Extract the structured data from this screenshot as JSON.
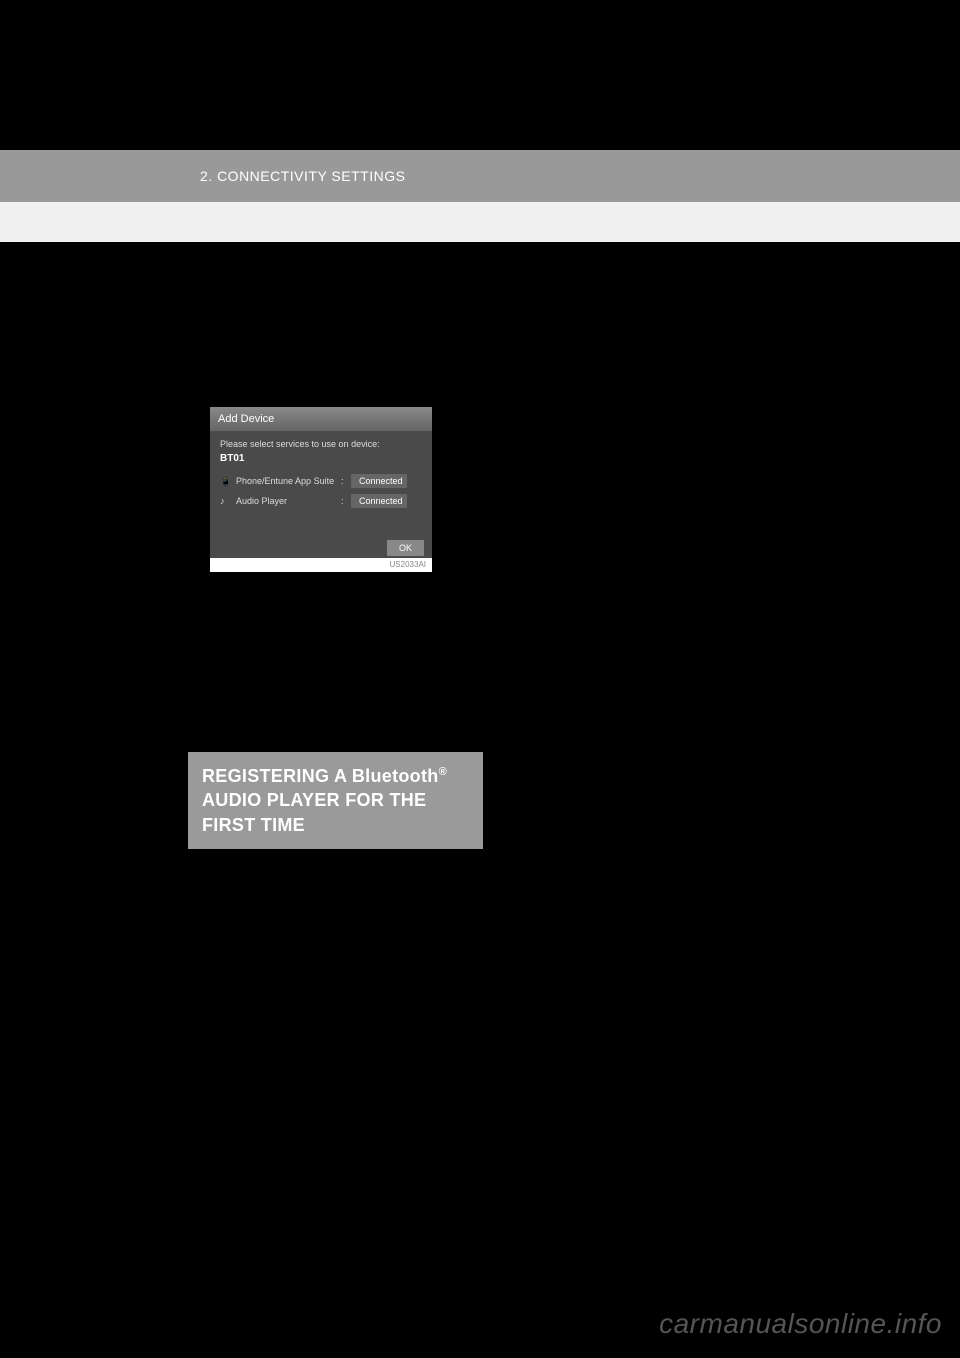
{
  "header": {
    "section_label": "2. CONNECTIVITY SETTINGS"
  },
  "screenshot": {
    "title": "Add Device",
    "prompt": "Please select services to use on device:",
    "device": "BT01",
    "services": [
      {
        "icon": "phone-icon",
        "name": "Phone/Entune App Suite",
        "status": "Connected"
      },
      {
        "icon": "music-icon",
        "name": "Audio Player",
        "status": "Connected"
      }
    ],
    "ok_label": "OK",
    "ref_code": "US2033AI"
  },
  "section": {
    "heading_line1": "REGISTERING A Bluetooth",
    "heading_super": "®",
    "heading_line2": "AUDIO PLAYER FOR THE FIRST TIME"
  },
  "watermark": "carmanualsonline.info"
}
